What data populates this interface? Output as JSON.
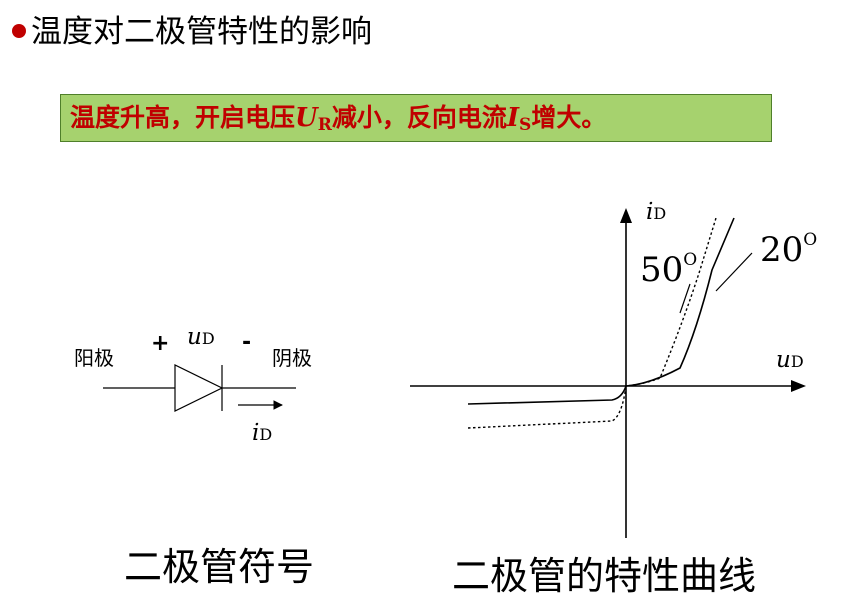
{
  "heading": {
    "text": "温度对二极管特性的影响"
  },
  "callout": {
    "text_a": "温度升高，开启电压",
    "sym_u": "U",
    "sub_r": "R",
    "text_b": "减小，反向电流",
    "sym_i": "I",
    "sub_s": "S",
    "text_c": "增大。"
  },
  "symbol": {
    "anode_label": "阳极",
    "cathode_label": "阴极",
    "plus": "+",
    "minus": "-",
    "voltage_sym": "u",
    "voltage_sub": "D",
    "current_sym": "i",
    "current_sub": "D",
    "caption": "二极管符号"
  },
  "curve": {
    "y_axis_sym": "i",
    "y_axis_sub": "D",
    "x_axis_sym": "u",
    "x_axis_sub": "D",
    "label_50": "50",
    "label_20": "20",
    "degree": "O",
    "caption": "二极管的特性曲线"
  },
  "colors": {
    "callout_bg": "#a6d26e",
    "callout_text": "#c00000",
    "bullet": "#c00000"
  }
}
